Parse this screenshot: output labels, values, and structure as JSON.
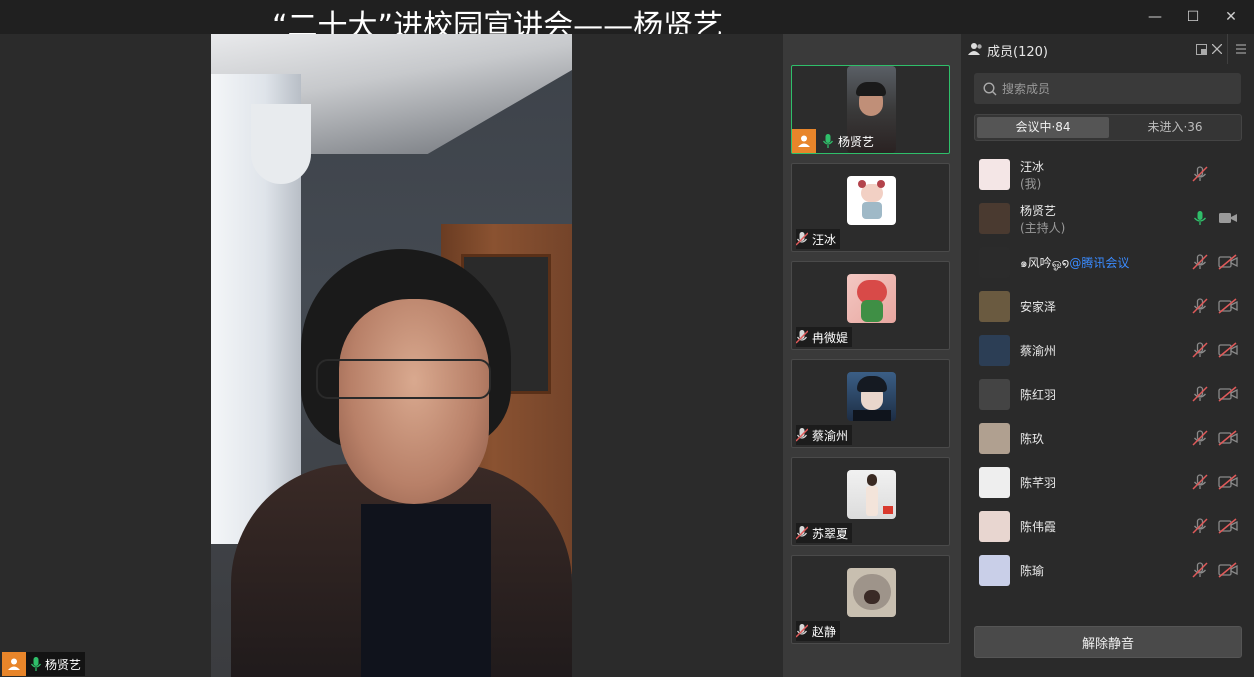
{
  "window": {
    "title": "“二十大”进校园宣讲会——杨贤艺",
    "minimize_glyph": "—",
    "maximize_glyph": "☐",
    "close_glyph": "✕"
  },
  "main_video": {
    "speaker_name": "杨贤艺",
    "mic_state": "on"
  },
  "video_strip": [
    {
      "name": "杨贤艺",
      "is_host": true,
      "mic": "on",
      "active": true,
      "avatar_icon": "person-photo-icon"
    },
    {
      "name": "汪冰",
      "is_host": false,
      "mic": "muted",
      "active": false,
      "avatar_icon": "doll-avatar-icon"
    },
    {
      "name": "冉微媞",
      "is_host": false,
      "mic": "muted",
      "active": false,
      "avatar_icon": "toy-avatar-icon"
    },
    {
      "name": "蔡渝州",
      "is_host": false,
      "mic": "muted",
      "active": false,
      "avatar_icon": "anime-avatar-icon"
    },
    {
      "name": "苏翠夏",
      "is_host": false,
      "mic": "muted",
      "active": false,
      "avatar_icon": "photo-avatar-icon"
    },
    {
      "name": "赵静",
      "is_host": false,
      "mic": "muted",
      "active": false,
      "avatar_icon": "cat-avatar-icon"
    }
  ],
  "members_panel": {
    "title": "成员(120)",
    "search_placeholder": "搜索成员",
    "tabs": [
      {
        "label": "会议中·84",
        "selected": true
      },
      {
        "label": "未进入·36",
        "selected": false
      }
    ],
    "members": [
      {
        "name": "汪冰",
        "sub": "(我)",
        "mic": "muted",
        "cam": "none"
      },
      {
        "name": "杨贤艺",
        "sub": "(主持人)",
        "mic": "on",
        "cam": "on"
      },
      {
        "name": "๑风吟ஓ໑",
        "suffix": "@腾讯会议",
        "mic": "muted",
        "cam": "off"
      },
      {
        "name": "安家泽",
        "mic": "muted",
        "cam": "off"
      },
      {
        "name": "蔡渝州",
        "mic": "muted",
        "cam": "off"
      },
      {
        "name": "陈红羽",
        "mic": "muted",
        "cam": "off"
      },
      {
        "name": "陈玖",
        "mic": "muted",
        "cam": "off"
      },
      {
        "name": "陈芊羽",
        "mic": "muted",
        "cam": "off"
      },
      {
        "name": "陈伟霞",
        "mic": "muted",
        "cam": "off"
      },
      {
        "name": "陈瑜",
        "mic": "muted",
        "cam": "off"
      }
    ],
    "unmute_label": "解除静音"
  },
  "colors": {
    "host_badge": "#e8852a",
    "mic_on": "#2fbf6a",
    "muted_red": "#e05a5a",
    "active_border": "#2fbf6a",
    "link_blue": "#3a8bff"
  }
}
